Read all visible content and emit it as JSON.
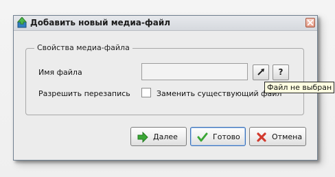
{
  "window": {
    "title": "Добавить новый медиа-файл"
  },
  "group": {
    "title": "Свойства медиа-файла"
  },
  "form": {
    "filename_label": "Имя файла",
    "filename_value": "",
    "browse_icon": "arrow-up-right-icon",
    "help_label": "?",
    "overwrite_label": "Разрешить перезапись",
    "replace_checkbox_label": "Заменить существующий файл",
    "replace_checked": false
  },
  "tooltip": {
    "text": "Файл не выбран"
  },
  "buttons": {
    "next_label": "Далее",
    "ok_label": "Готово",
    "cancel_label": "Отмена"
  },
  "colors": {
    "next_arrow": "#3aa635",
    "ok_check": "#3aa635",
    "cancel_x": "#d23a2e"
  }
}
